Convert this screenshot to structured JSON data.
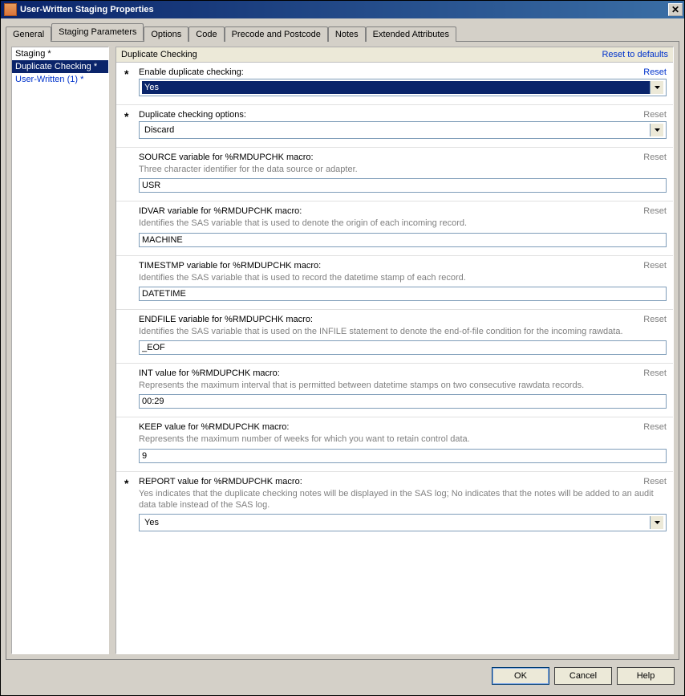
{
  "window": {
    "title": "User-Written Staging Properties"
  },
  "tabs": {
    "general": "General",
    "staging_parameters": "Staging Parameters",
    "options": "Options",
    "code": "Code",
    "precode_postcode": "Precode and Postcode",
    "notes": "Notes",
    "extended_attributes": "Extended Attributes"
  },
  "sidebar": {
    "items": [
      {
        "label": "Staging *"
      },
      {
        "label": "Duplicate Checking *"
      },
      {
        "label": "User-Written (1) *"
      }
    ]
  },
  "pane": {
    "title": "Duplicate Checking",
    "reset_defaults": "Reset to defaults"
  },
  "fields": {
    "enable": {
      "label": "Enable duplicate checking:",
      "reset": "Reset",
      "value": "Yes"
    },
    "options": {
      "label": "Duplicate checking options:",
      "reset": "Reset",
      "value": "Discard"
    },
    "source": {
      "label": "SOURCE variable for %RMDUPCHK macro:",
      "reset": "Reset",
      "desc": "Three character identifier for the data source or adapter.",
      "value": "USR"
    },
    "idvar": {
      "label": "IDVAR variable for %RMDUPCHK macro:",
      "reset": "Reset",
      "desc": "Identifies the SAS variable that is used to denote the origin of each incoming record.",
      "value": "MACHINE"
    },
    "timestmp": {
      "label": "TIMESTMP variable for %RMDUPCHK macro:",
      "reset": "Reset",
      "desc": "Identifies the SAS variable that is used to record the datetime stamp of each record.",
      "value": "DATETIME"
    },
    "endfile": {
      "label": "ENDFILE variable for %RMDUPCHK macro:",
      "reset": "Reset",
      "desc": "Identifies the SAS variable that is used on the INFILE statement to denote the end-of-file condition for the incoming rawdata.",
      "value": "_EOF"
    },
    "int": {
      "label": "INT value for %RMDUPCHK macro:",
      "reset": "Reset",
      "desc": "Represents the maximum interval that is permitted between datetime stamps on two consecutive rawdata records.",
      "value": "00:29"
    },
    "keep": {
      "label": "KEEP value for %RMDUPCHK macro:",
      "reset": "Reset",
      "desc": "Represents the maximum number of weeks for which you want to retain control data.",
      "value": "9"
    },
    "report": {
      "label": "REPORT value for %RMDUPCHK macro:",
      "reset": "Reset",
      "desc": "Yes indicates that the duplicate checking notes will be displayed in the SAS log; No indicates that the notes will be added to an audit data table instead of the SAS log.",
      "value": "Yes"
    }
  },
  "buttons": {
    "ok": "OK",
    "cancel": "Cancel",
    "help": "Help"
  }
}
